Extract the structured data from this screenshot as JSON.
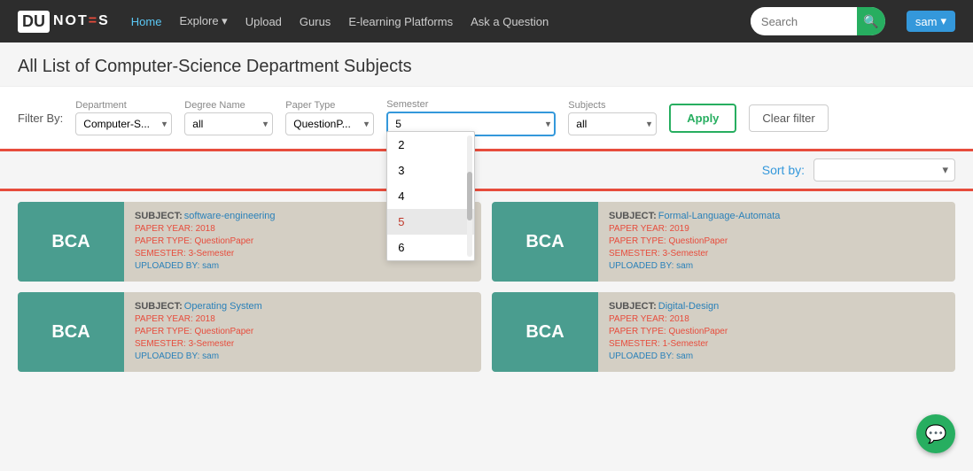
{
  "navbar": {
    "brand_du": "DU",
    "brand_notes": "NOT=S",
    "links": [
      {
        "label": "Home",
        "active": true
      },
      {
        "label": "Explore ▾",
        "active": false
      },
      {
        "label": "Upload",
        "active": false
      },
      {
        "label": "Gurus",
        "active": false
      },
      {
        "label": "E-learning Platforms",
        "active": false
      },
      {
        "label": "Ask a Question",
        "active": false
      }
    ],
    "search_placeholder": "Search",
    "search_button_label": "🔍",
    "user": "sam"
  },
  "page": {
    "title": "All List of Computer-Science Department Subjects"
  },
  "filter": {
    "label": "Filter By:",
    "department_label": "Department",
    "department_value": "Computer-S...",
    "degree_label": "Degree Name",
    "degree_value": "all",
    "paper_type_label": "Paper Type",
    "paper_type_value": "QuestionP...",
    "semester_label": "Semester",
    "semester_value": "5",
    "semester_options": [
      "2",
      "3",
      "4",
      "5",
      "6"
    ],
    "subjects_label": "Subjects",
    "subjects_value": "all",
    "apply_label": "Apply",
    "clear_label": "Clear filter"
  },
  "sort": {
    "label": "Sort by:",
    "value": ""
  },
  "cards": [
    {
      "badge": "BCA",
      "subject_label": "SUBJECT:",
      "subject_value": "software-engineering",
      "paper_year_label": "PAPER YEAR:",
      "paper_year": "2018",
      "paper_type_label": "PAPER TYPE:",
      "paper_type": "QuestionPaper",
      "semester_label": "SEMESTER:",
      "semester": "3-Semester",
      "uploaded_label": "UPLOADED BY:",
      "uploaded_by": "sam"
    },
    {
      "badge": "BCA",
      "subject_label": "SUBJECT:",
      "subject_value": "Formal-Language-Automata",
      "paper_year_label": "PAPER YEAR:",
      "paper_year": "2019",
      "paper_type_label": "PAPER TYPE:",
      "paper_type": "QuestionPaper",
      "semester_label": "SEMESTER:",
      "semester": "3-Semester",
      "uploaded_label": "UPLOADED BY:",
      "uploaded_by": "sam"
    },
    {
      "badge": "BCA",
      "subject_label": "SUBJECT:",
      "subject_value": "Operating System",
      "paper_year_label": "PAPER YEAR:",
      "paper_year": "2018",
      "paper_type_label": "PAPER TYPE:",
      "paper_type": "QuestionPaper",
      "semester_label": "SEMESTER:",
      "semester": "3-Semester",
      "uploaded_label": "UPLOADED BY:",
      "uploaded_by": "sam"
    },
    {
      "badge": "BCA",
      "subject_label": "SUBJECT:",
      "subject_value": "Digital-Design",
      "paper_year_label": "PAPER YEAR:",
      "paper_year": "2018",
      "paper_type_label": "PAPER TYPE:",
      "paper_type": "QuestionPaper",
      "semester_label": "SEMESTER:",
      "semester": "1-Semester",
      "uploaded_label": "UPLOADED BY:",
      "uploaded_by": "sam"
    }
  ],
  "chat_icon": "💬"
}
